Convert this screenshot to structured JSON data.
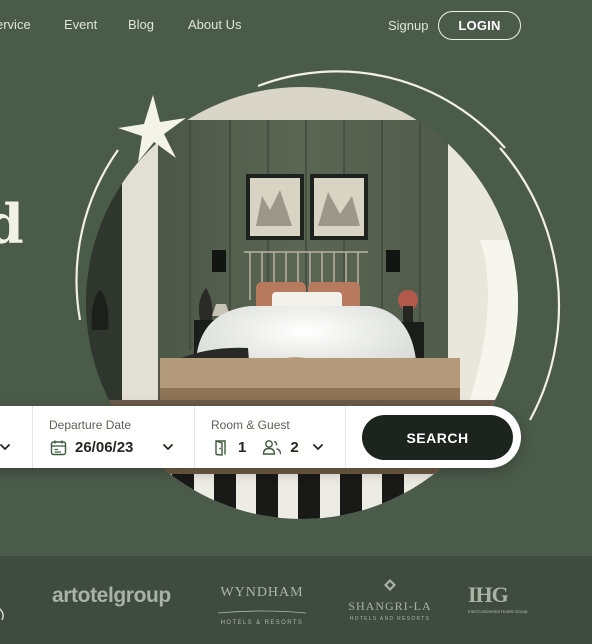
{
  "nav": {
    "items": [
      "ervice",
      "Event",
      "Blog",
      "About Us"
    ],
    "signup": "Signup",
    "login": "LOGIN"
  },
  "hero": {
    "headline_fragment": "d"
  },
  "search": {
    "departure": {
      "label": "Departure Date",
      "value": "26/06/23"
    },
    "room_guest": {
      "label": "Room & Guest",
      "rooms": "1",
      "guests": "2"
    },
    "button": "SEARCH"
  },
  "partners": {
    "artotel": "artotelgroup",
    "wyndham": {
      "name": "WYNDHAM",
      "tagline": "HOTELS & RESORTS"
    },
    "shangri_la": {
      "name": "SHANGRI-LA",
      "tagline": "HOTELS AND RESORTS"
    },
    "ihg": {
      "name": "IHG",
      "tagline": "InterContinental Hotels Group"
    }
  },
  "colors": {
    "background": "#4b5b4a",
    "footer": "#3f4b3f",
    "button": "#1d241d"
  }
}
